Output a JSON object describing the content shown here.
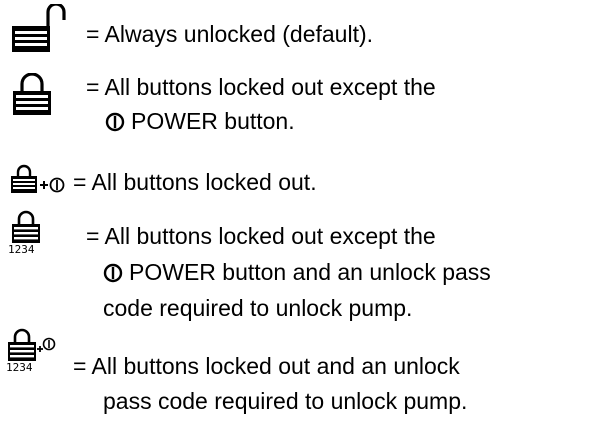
{
  "lock_legend": [
    {
      "icon": "padlock-unlocked-icon",
      "lines": [
        "= Always unlocked (default)."
      ]
    },
    {
      "icon": "padlock-locked-icon",
      "lines": [
        "= All buttons locked out except the",
        "POWER button."
      ]
    },
    {
      "icon": "padlock-locked-plus-power-icon",
      "lines": [
        "= All buttons locked out."
      ]
    },
    {
      "icon": "padlock-locked-passcode-icon",
      "icon_digits": "1234",
      "lines": [
        "= All buttons locked out except the",
        "POWER button and an unlock pass",
        "code required to unlock pump."
      ]
    },
    {
      "icon": "padlock-locked-plus-power-passcode-icon",
      "icon_digits": "1234",
      "lines": [
        "= All buttons locked out and an unlock",
        "pass code required to unlock pump."
      ]
    }
  ]
}
